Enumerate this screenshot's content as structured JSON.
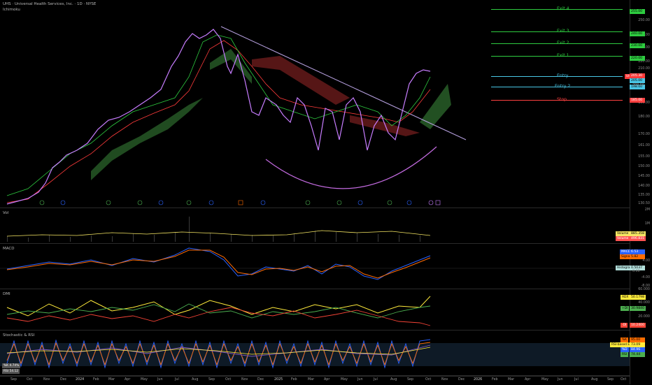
{
  "header": {
    "symbol_line": "UHS · Universal Health Services, Inc. · 1D · NYSE",
    "indicator": "Ichimoku"
  },
  "panes": {
    "vol": "Vol",
    "macd": "MACD",
    "dmi": "DMI",
    "stoch": "Stochastic & RSI"
  },
  "price_axis": [
    "250.00",
    "240.00",
    "230.00",
    "220.00",
    "210.00",
    "200.00",
    "190.00",
    "180.00",
    "170.00",
    "161.00",
    "155.00",
    "150.00",
    "145.00",
    "140.00",
    "135.00",
    "130.50"
  ],
  "levels": [
    {
      "label": "Exit 4",
      "color": "#2ecc40",
      "tag": "255.00"
    },
    {
      "label": "Exit 3",
      "color": "#2ecc40",
      "tag": "240.00"
    },
    {
      "label": "Exit 2",
      "color": "#2ecc40",
      "tag": "230.00"
    },
    {
      "label": "Exit 1",
      "color": "#2ecc40",
      "tag": "220.00"
    },
    {
      "label": "Entry",
      "color": "#49c6e5",
      "tag": "205.00"
    },
    {
      "label": "Entry 2",
      "color": "#49c6e5",
      "tag": "198.00"
    },
    {
      "label": "Stop",
      "color": "#ff4040",
      "tag": "185.00"
    }
  ],
  "price_tags": [
    "205.30",
    "205.00",
    "198.00",
    "185.00"
  ],
  "uhs_label": "UHS",
  "vol_axis": {
    "top": "2M",
    "mid": "1M"
  },
  "vol_tags": [
    {
      "label": "Volume MA",
      "value": "885.358"
    },
    {
      "label": "Volume",
      "value": "496.831"
    }
  ],
  "macd_axis": [
    "4.00",
    "0.00",
    "-4.00",
    "-8.00"
  ],
  "macd_tags": [
    {
      "label": "MACD",
      "value": "6.53"
    },
    {
      "label": "Signal",
      "value": "5.82"
    },
    {
      "label": "Histogram",
      "value": "0.5037"
    }
  ],
  "dmi_axis": [
    "60.000",
    "40.000",
    "20.000"
  ],
  "dmi_tags": [
    {
      "label": "ADX",
      "value": "50.1798"
    },
    {
      "label": "+DI",
      "value": "30.9840"
    },
    {
      "label": "-DI",
      "value": "10.2400"
    }
  ],
  "stoch_tags": [
    {
      "label": "%K",
      "value": "95.00"
    },
    {
      "label": "RSI-based EMA",
      "value": "73.09"
    },
    {
      "label": "%D",
      "value": "84.96"
    },
    {
      "label": "RSI",
      "value": "74.44"
    }
  ],
  "stoch_left_tags": [
    "%K 4.74%",
    "RSI 54.12"
  ],
  "x_labels": [
    "Sep",
    "Oct",
    "Nov",
    "Dec",
    "2024",
    "Feb",
    "Mar",
    "Apr",
    "May",
    "Jun",
    "Jul",
    "Aug",
    "Sep",
    "Oct",
    "Nov",
    "Dec",
    "2025",
    "Feb",
    "Mar",
    "Apr",
    "May",
    "Jun",
    "Jul",
    "Aug",
    "Sep",
    "Oct",
    "Nov",
    "Dec",
    "2026",
    "Feb",
    "Mar",
    "Apr",
    "May",
    "Jun",
    "Jul",
    "Aug",
    "Sep",
    "Oct"
  ],
  "colors": {
    "price": "#c77dff",
    "conversion": "#2ecc40",
    "base": "#ff3b3b",
    "trendline": "#b39ddb",
    "cloud_bull": "#2d6b2d",
    "cloud_bear": "#7a2020",
    "volume_ma": "#f5e663",
    "macd": "#2962ff",
    "signal": "#ff6d00",
    "adx": "#ffeb3b",
    "plus_di": "#4caf50",
    "minus_di": "#f44336",
    "stoch_k": "#2962ff",
    "stoch_d": "#ff6d00",
    "rsi": "#7e57c2",
    "rsi_ema": "#ffeb3b"
  }
}
